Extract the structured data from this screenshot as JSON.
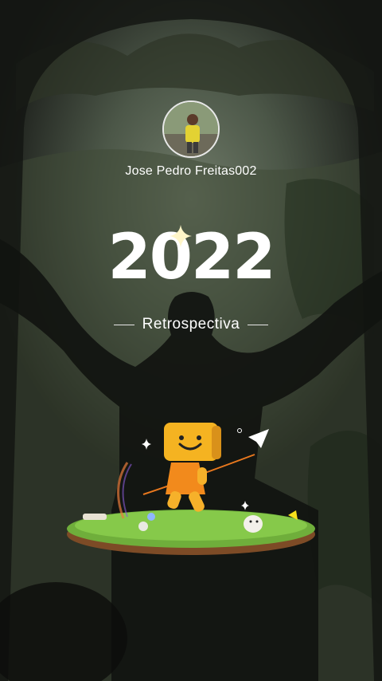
{
  "profile": {
    "username": "Jose Pedro Freitas002"
  },
  "hero": {
    "year": "2022",
    "subtitle": "Retrospectiva"
  },
  "icons": {
    "sparkle": "sparkle-icon",
    "paper_plane": "paper-plane-icon"
  }
}
